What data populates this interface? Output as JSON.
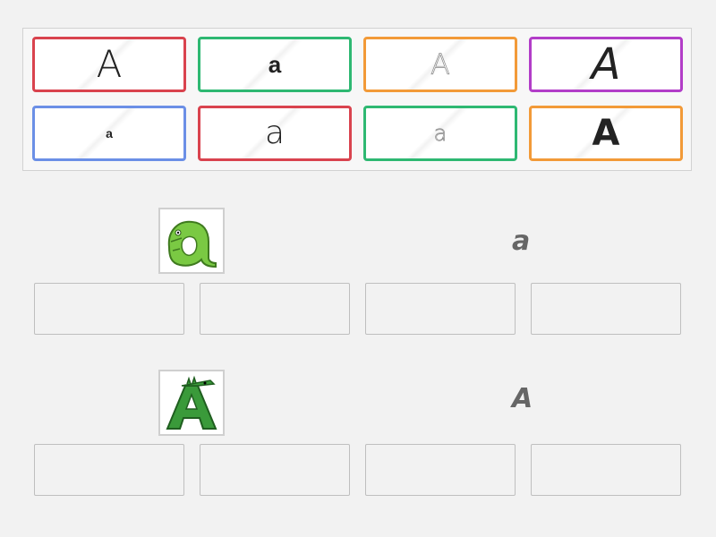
{
  "cards": [
    {
      "text": "A",
      "color": "#d9434e"
    },
    {
      "text": "a",
      "color": "#2eb872"
    },
    {
      "text": "A",
      "color": "#f29a38"
    },
    {
      "text": "A",
      "color": "#b23dc8"
    },
    {
      "text": "a",
      "color": "#6b8fe6"
    },
    {
      "text": "a",
      "color": "#d9434e"
    },
    {
      "text": "a",
      "color": "#2eb872"
    },
    {
      "text": "A",
      "color": "#f29a38"
    }
  ],
  "groups": [
    {
      "label": "a",
      "image_icon": "green-crocodile-lowercase-a-icon"
    },
    {
      "label": "A",
      "image_icon": "green-crocodile-uppercase-a-icon"
    }
  ]
}
